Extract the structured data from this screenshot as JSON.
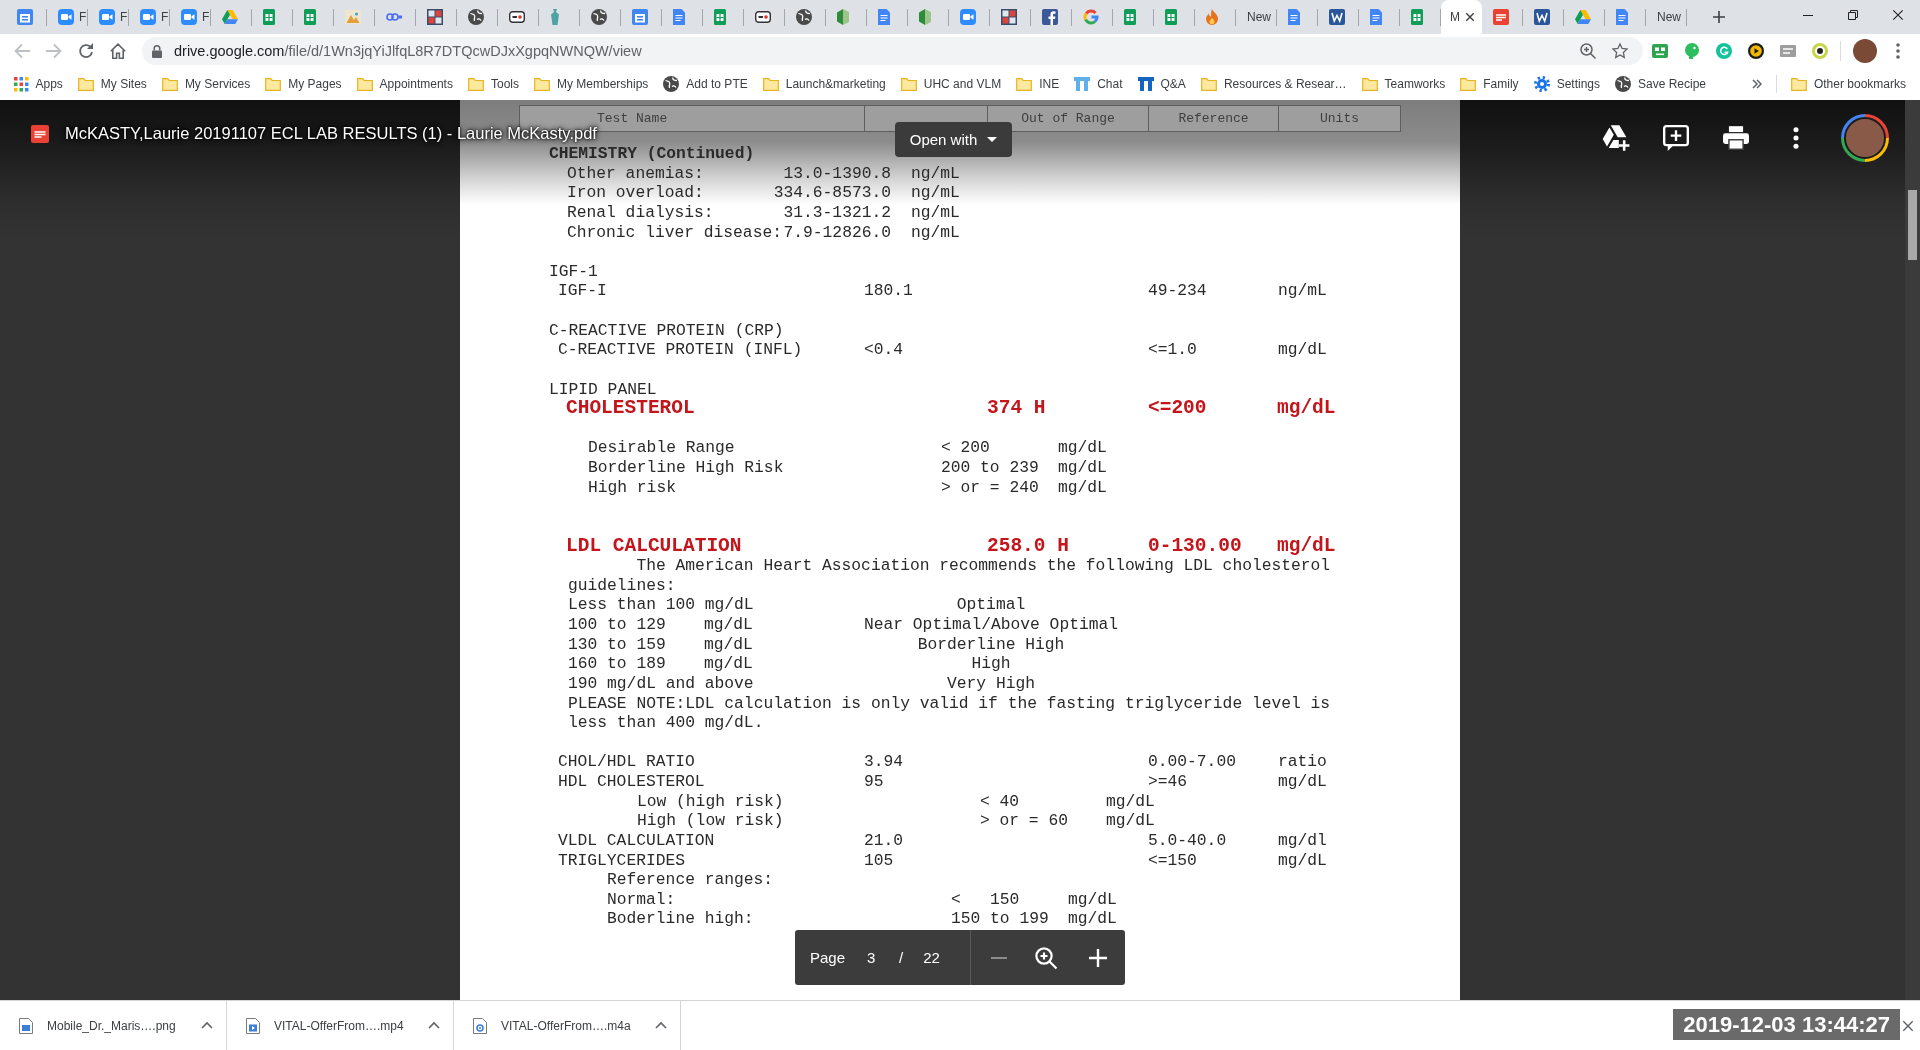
{
  "tabs": [
    {
      "kind": "calendar",
      "selected": false
    },
    {
      "kind": "video",
      "label": "F",
      "selected": false
    },
    {
      "kind": "video",
      "label": "F",
      "selected": false
    },
    {
      "kind": "video",
      "label": "F",
      "selected": false
    },
    {
      "kind": "video",
      "label": "F",
      "selected": false
    },
    {
      "kind": "triangle",
      "selected": false
    },
    {
      "kind": "sheet",
      "selected": false
    },
    {
      "kind": "sheet",
      "selected": false
    },
    {
      "kind": "image",
      "selected": false
    },
    {
      "kind": "link",
      "selected": false
    },
    {
      "kind": "grid",
      "selected": false
    },
    {
      "kind": "globe",
      "selected": false
    },
    {
      "kind": "window",
      "selected": false
    },
    {
      "kind": "figure",
      "selected": false
    },
    {
      "kind": "globe",
      "selected": false
    },
    {
      "kind": "calendar",
      "selected": false
    },
    {
      "kind": "doc",
      "selected": false
    },
    {
      "kind": "sheet",
      "selected": false
    },
    {
      "kind": "window",
      "selected": false
    },
    {
      "kind": "globe",
      "selected": false
    },
    {
      "kind": "wedge",
      "selected": false
    },
    {
      "kind": "doc",
      "selected": false
    },
    {
      "kind": "wedge",
      "selected": false
    },
    {
      "kind": "video",
      "selected": false
    },
    {
      "kind": "grid",
      "selected": false
    },
    {
      "kind": "flogo",
      "selected": false
    },
    {
      "kind": "glogo",
      "selected": false
    },
    {
      "kind": "sheet",
      "selected": false
    },
    {
      "kind": "sheet",
      "selected": false
    },
    {
      "kind": "flame",
      "selected": false
    },
    {
      "label": "New",
      "selected": false
    },
    {
      "kind": "doc",
      "selected": false
    },
    {
      "kind": "wlogo",
      "selected": false
    },
    {
      "kind": "doc",
      "selected": false
    },
    {
      "kind": "sheet",
      "selected": false
    },
    {
      "label": "M",
      "selected": true
    },
    {
      "kind": "pdf",
      "selected": false
    },
    {
      "kind": "wlogo",
      "selected": false
    },
    {
      "kind": "triangle",
      "selected": false
    },
    {
      "kind": "doc",
      "selected": false
    },
    {
      "label": "New",
      "selected": false
    }
  ],
  "toolbar": {
    "back": {
      "disabled": true
    },
    "forward": {
      "disabled": true
    },
    "url": {
      "host": "drive.google.com",
      "path": "/file/d/1Wn3jqYiJlfqL8R7DTQcwDJxXgpqNWNQW/view"
    }
  },
  "bookmarks": [
    {
      "kind": "apps",
      "label": "Apps"
    },
    {
      "kind": "folder",
      "label": "My Sites"
    },
    {
      "kind": "folder",
      "label": "My Services"
    },
    {
      "kind": "folder",
      "label": "My Pages"
    },
    {
      "kind": "folder",
      "label": "Appointments"
    },
    {
      "kind": "folder",
      "label": "Tools"
    },
    {
      "kind": "folder",
      "label": "My Memberships"
    },
    {
      "kind": "globe",
      "label": "Add to PTE"
    },
    {
      "kind": "folder",
      "label": "Launch&marketing"
    },
    {
      "kind": "folder",
      "label": "UHC and VLM"
    },
    {
      "kind": "folder",
      "label": "INE"
    },
    {
      "kind": "pillars",
      "label": "Chat",
      "color": "#5fb0ea"
    },
    {
      "kind": "pillars",
      "label": "Q&A",
      "color": "#1565c0"
    },
    {
      "kind": "folder",
      "label": "Resources & Resear…"
    },
    {
      "kind": "folder",
      "label": "Teamworks"
    },
    {
      "kind": "folder",
      "label": "Family"
    },
    {
      "kind": "gear",
      "label": "Settings"
    },
    {
      "kind": "globe",
      "label": "Save Recipe"
    }
  ],
  "other_bookmarks": {
    "label": "Other bookmarks"
  },
  "viewer": {
    "title": "McKASTY,Laurie 20191107 ECL LAB RESULTS (1) - Laurie McKasty.pdf",
    "open_with": "Open with"
  },
  "report": {
    "columns": [
      "Test Name",
      "Out of Range",
      "Reference",
      "Units"
    ],
    "groups": [
      {
        "lines": [
          {
            "kind": "section",
            "text": "CHEMISTRY (Continued)"
          },
          {
            "kind": "range",
            "label": "Other anemias:",
            "value": "13.0-1390.8",
            "unit": "ng/mL"
          },
          {
            "kind": "range",
            "label": "Iron overload:",
            "value": "334.6-8573.0",
            "unit": "ng/mL"
          },
          {
            "kind": "range",
            "label": "Renal dialysis:",
            "value": "31.3-1321.2",
            "unit": "ng/mL"
          },
          {
            "kind": "range",
            "label": "Chronic liver disease:",
            "value": "7.9-12826.0",
            "unit": "ng/mL"
          }
        ]
      },
      {
        "lines": [
          {
            "kind": "group",
            "text": "IGF-1"
          },
          {
            "kind": "result",
            "name": "IGF-I",
            "value": "180.1",
            "reference": "49-234",
            "unit": "ng/mL",
            "flagged": false
          }
        ]
      },
      {
        "lines": [
          {
            "kind": "group",
            "text": "C-REACTIVE PROTEIN (CRP)"
          },
          {
            "kind": "result",
            "name": "C-REACTIVE PROTEIN (INFL)",
            "value": "<0.4",
            "reference": "<=1.0",
            "unit": "mg/dL",
            "flagged": false
          }
        ]
      },
      {
        "lines": [
          {
            "kind": "group",
            "text": "LIPID PANEL"
          },
          {
            "kind": "result",
            "name": "CHOLESTEROL",
            "value": "374 H",
            "reference": "<=200",
            "unit": "mg/dL",
            "flagged": true
          }
        ]
      },
      {
        "lines": [
          {
            "kind": "note",
            "label": "Desirable Range",
            "value": "< 200",
            "unit": "mg/dL"
          },
          {
            "kind": "note",
            "label": "Borderline High Risk",
            "value": "200 to 239",
            "unit": "mg/dL"
          },
          {
            "kind": "note",
            "label": "High risk",
            "value": "> or = 240",
            "unit": "mg/dL"
          }
        ]
      },
      {
        "lines": [
          {
            "kind": "result",
            "name": "LDL CALCULATION",
            "value": "258.0 H",
            "reference": "0-130.00",
            "unit": "mg/dL",
            "flagged": true
          },
          {
            "kind": "paragraph",
            "indented": true,
            "text": "The American Heart Association recommends the following LDL cholesterol guidelines:"
          },
          {
            "kind": "guideline",
            "range": "Less than 100 mg/dL",
            "category": "Optimal"
          },
          {
            "kind": "guideline",
            "range": "100 to 129",
            "unit": "mg/dL",
            "category": "Near Optimal/Above Optimal"
          },
          {
            "kind": "guideline",
            "range": "130 to 159",
            "unit": "mg/dL",
            "category": "Borderline High"
          },
          {
            "kind": "guideline",
            "range": "160 to 189",
            "unit": "mg/dL",
            "category": "High"
          },
          {
            "kind": "guideline",
            "range": "190 mg/dL and above",
            "category": "Very High"
          },
          {
            "kind": "paragraph",
            "indented": false,
            "text": "PLEASE NOTE:LDL calculation is only valid if the fasting triglyceride level is less than 400 mg/dL."
          }
        ]
      },
      {
        "lines": [
          {
            "kind": "result",
            "name": "CHOL/HDL RATIO",
            "value": "3.94",
            "reference": "0.00-7.00",
            "unit": "ratio",
            "flagged": false
          },
          {
            "kind": "result",
            "name": "HDL CHOLESTEROL",
            "value": "95",
            "reference": ">=46",
            "unit": "mg/dL",
            "flagged": false
          },
          {
            "kind": "subrange",
            "label": "Low (high risk)",
            "value": "< 40",
            "unit": "mg/dL"
          },
          {
            "kind": "subrange",
            "label": "High (low risk)",
            "value": "> or = 60",
            "unit": "mg/dL"
          },
          {
            "kind": "result",
            "name": "VLDL CALCULATION",
            "value": "21.0",
            "reference": "5.0-40.0",
            "unit": "mg/dl",
            "flagged": false
          },
          {
            "kind": "result",
            "name": "TRIGLYCERIDES",
            "value": "105",
            "reference": "<=150",
            "unit": "mg/dL",
            "flagged": false
          },
          {
            "kind": "subheading",
            "text": "Reference ranges:"
          },
          {
            "kind": "refrange",
            "label": "Normal:",
            "value": "<   150",
            "unit": "mg/dL"
          },
          {
            "kind": "refrange",
            "label": "Boderline high:",
            "value": "150 to 199",
            "unit": "mg/dL"
          }
        ]
      }
    ]
  },
  "page_bar": {
    "label": "Page",
    "page": "3",
    "separator": "/",
    "total": "22",
    "zoom_out": {
      "disabled": true
    }
  },
  "downloads": [
    {
      "kind": "image",
      "name": "Mobile_Dr._Maris….png"
    },
    {
      "kind": "video",
      "name": "VITAL-OfferFrom….mp4"
    },
    {
      "kind": "audio",
      "name": "VITAL-OfferFrom….m4a"
    }
  ],
  "timestamp": "2019-12-03 13:44:27"
}
